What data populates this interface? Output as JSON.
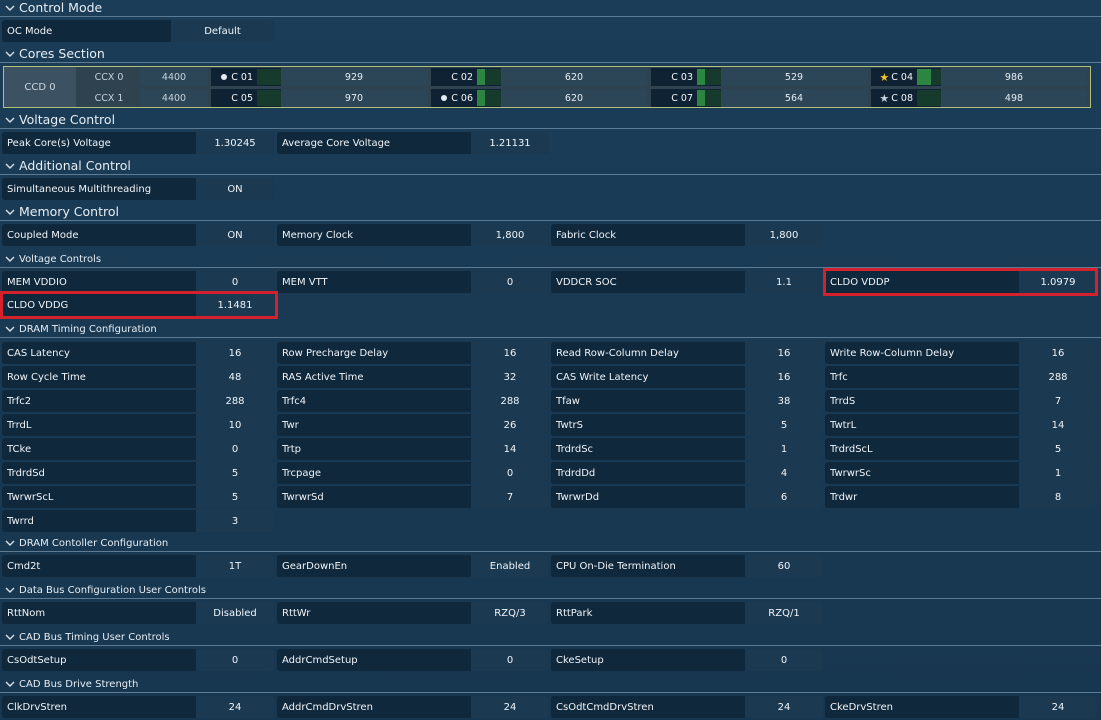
{
  "sections": {
    "control_mode": "Control Mode",
    "cores_section": "Cores Section",
    "voltage_control": "Voltage Control",
    "additional_control": "Additional Control",
    "memory_control": "Memory Control",
    "voltage_controls": "Voltage Controls",
    "dram_timing": "DRAM Timing Configuration",
    "dram_controller": "DRAM Contoller Configuration",
    "data_bus": "Data Bus Configuration User Controls",
    "cad_bus_timing": "CAD Bus Timing User Controls",
    "cad_bus_drive": "CAD Bus Drive Strength"
  },
  "oc_mode": {
    "label": "OC Mode",
    "value": "Default"
  },
  "cores": {
    "ccd": "CCD 0",
    "ccx": [
      {
        "label": "CCX 0",
        "freq": "4400"
      },
      {
        "label": "CCX 1",
        "freq": "4400"
      }
    ],
    "items": [
      {
        "name": "C 01",
        "value": "929",
        "marker": "dot",
        "level": 0
      },
      {
        "name": "C 02",
        "value": "620",
        "marker": "",
        "level": 0.35
      },
      {
        "name": "C 03",
        "value": "529",
        "marker": "",
        "level": 0.35
      },
      {
        "name": "C 04",
        "value": "986",
        "marker": "★",
        "marker_color": "#f2c230",
        "level": 0.6
      },
      {
        "name": "C 05",
        "value": "970",
        "marker": "",
        "level": 0
      },
      {
        "name": "C 06",
        "value": "620",
        "marker": "dot",
        "level": 0.35
      },
      {
        "name": "C 07",
        "value": "564",
        "marker": "",
        "level": 0.35
      },
      {
        "name": "C 08",
        "value": "498",
        "marker": "★",
        "marker_color": "#c8d2dc",
        "level": 0
      }
    ]
  },
  "voltage_control": [
    {
      "label": "Peak Core(s) Voltage",
      "value": "1.30245"
    },
    {
      "label": "Average Core Voltage",
      "value": "1.21131"
    }
  ],
  "smt": {
    "label": "Simultaneous Multithreading",
    "value": "ON"
  },
  "memory_control": [
    {
      "label": "Coupled Mode",
      "value": "ON"
    },
    {
      "label": "Memory Clock",
      "value": "1,800"
    },
    {
      "label": "Fabric Clock",
      "value": "1,800"
    }
  ],
  "voltage_controls": [
    {
      "label": "MEM VDDIO",
      "value": "0"
    },
    {
      "label": "MEM VTT",
      "value": "0"
    },
    {
      "label": "VDDCR SOC",
      "value": "1.1"
    },
    {
      "label": "CLDO VDDP",
      "value": "1.0979"
    },
    {
      "label": "CLDO VDDG",
      "value": "1.1481"
    }
  ],
  "dram_timing": [
    {
      "label": "CAS Latency",
      "value": "16"
    },
    {
      "label": "Row Precharge Delay",
      "value": "16"
    },
    {
      "label": "Read Row-Column Delay",
      "value": "16"
    },
    {
      "label": "Write Row-Column Delay",
      "value": "16"
    },
    {
      "label": "Row Cycle Time",
      "value": "48"
    },
    {
      "label": "RAS Active Time",
      "value": "32"
    },
    {
      "label": "CAS Write Latency",
      "value": "16"
    },
    {
      "label": "Trfc",
      "value": "288"
    },
    {
      "label": "Trfc2",
      "value": "288"
    },
    {
      "label": "Trfc4",
      "value": "288"
    },
    {
      "label": "Tfaw",
      "value": "38"
    },
    {
      "label": "TrrdS",
      "value": "7"
    },
    {
      "label": "TrrdL",
      "value": "10"
    },
    {
      "label": "Twr",
      "value": "26"
    },
    {
      "label": "TwtrS",
      "value": "5"
    },
    {
      "label": "TwtrL",
      "value": "14"
    },
    {
      "label": "TCke",
      "value": "0"
    },
    {
      "label": "Trtp",
      "value": "14"
    },
    {
      "label": "TrdrdSc",
      "value": "1"
    },
    {
      "label": "TrdrdScL",
      "value": "5"
    },
    {
      "label": "TrdrdSd",
      "value": "5"
    },
    {
      "label": "Trcpage",
      "value": "0"
    },
    {
      "label": "TrdrdDd",
      "value": "4"
    },
    {
      "label": "TwrwrSc",
      "value": "1"
    },
    {
      "label": "TwrwrScL",
      "value": "5"
    },
    {
      "label": "TwrwrSd",
      "value": "7"
    },
    {
      "label": "TwrwrDd",
      "value": "6"
    },
    {
      "label": "Trdwr",
      "value": "8"
    },
    {
      "label": "Twrrd",
      "value": "3"
    }
  ],
  "dram_controller": [
    {
      "label": "Cmd2t",
      "value": "1T"
    },
    {
      "label": "GearDownEn",
      "value": "Enabled"
    },
    {
      "label": "CPU On-Die Termination",
      "value": "60"
    }
  ],
  "data_bus": [
    {
      "label": "RttNom",
      "value": "Disabled"
    },
    {
      "label": "RttWr",
      "value": "RZQ/3"
    },
    {
      "label": "RttPark",
      "value": "RZQ/1"
    }
  ],
  "cad_bus_timing": [
    {
      "label": "CsOdtSetup",
      "value": "0"
    },
    {
      "label": "AddrCmdSetup",
      "value": "0"
    },
    {
      "label": "CkeSetup",
      "value": "0"
    }
  ],
  "cad_bus_drive": [
    {
      "label": "ClkDrvStren",
      "value": "24"
    },
    {
      "label": "AddrCmdDrvStren",
      "value": "24"
    },
    {
      "label": "CsOdtCmdDrvStren",
      "value": "24"
    },
    {
      "label": "CkeDrvStren",
      "value": "24"
    }
  ],
  "colors": {
    "highlight": "#d4212b",
    "core_bar": "#2c8540",
    "cores_border": "#b3c27a"
  }
}
